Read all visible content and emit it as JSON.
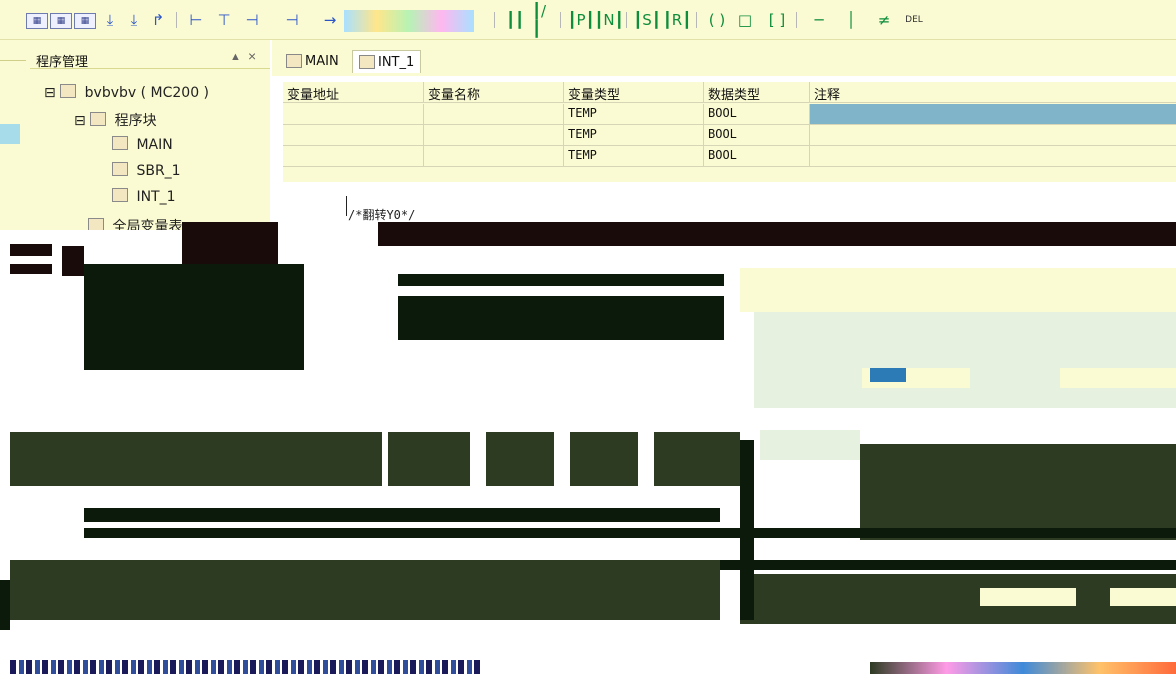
{
  "toolbar": {
    "groups": [
      {
        "icons": [
          "ladder-network-icon",
          "ladder-network-icon",
          "ladder-network-icon"
        ]
      },
      {
        "icons": [
          "down-arrow-icon",
          "down-arrow-icon",
          "branch-icon"
        ]
      },
      {
        "icons": [
          "insert-row-icon",
          "insert-row-icon",
          "insert-row-icon"
        ]
      },
      {
        "icons": [
          "contact-no-icon",
          "contact-nc-icon",
          "coil-icon"
        ]
      },
      {
        "icons": [
          "set-icon",
          "reset-icon",
          "box-icon"
        ]
      },
      {
        "icons": [
          "line-h-icon",
          "line-v-icon",
          "delete-line-icon"
        ]
      }
    ],
    "del_label": "DEL"
  },
  "panel": {
    "title": "程序管理",
    "tree": {
      "project": "bvbvbv ( MC200 )",
      "program_block": "程序块",
      "items": [
        "MAIN",
        "SBR_1",
        "INT_1"
      ],
      "global_vars": "全局变量表"
    }
  },
  "tabs": [
    {
      "label": "MAIN",
      "active": false
    },
    {
      "label": "INT_1",
      "active": true
    }
  ],
  "var_table": {
    "headers": [
      "变量地址",
      "变量名称",
      "变量类型",
      "数据类型",
      "注释"
    ],
    "rows": [
      [
        "",
        "",
        "TEMP",
        "BOOL",
        ""
      ],
      [
        "",
        "",
        "TEMP",
        "BOOL",
        ""
      ],
      [
        "",
        "",
        "TEMP",
        "BOOL",
        ""
      ]
    ]
  },
  "code": {
    "comment": "/*翻转Y0*/"
  }
}
